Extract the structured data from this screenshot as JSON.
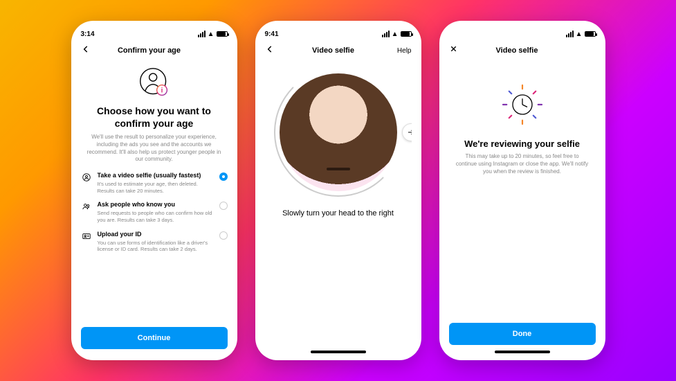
{
  "statusbar": {
    "time1": "3:14",
    "time2": "9:41",
    "time3": ""
  },
  "screen1": {
    "nav_title": "Confirm your age",
    "heading": "Choose how you want to confirm your age",
    "sub": "We'll use the result to personalize your experience, including the ads you see and the accounts we recommend. It'll also help us protect younger people in our community.",
    "options": [
      {
        "title": "Take a video selfie (usually fastest)",
        "desc": "It's used to estimate your age, then deleted. Results can take 20 minutes.",
        "selected": true
      },
      {
        "title": "Ask people who know you",
        "desc": "Send requests to people who can confirm how old you are. Results can take 3 days.",
        "selected": false
      },
      {
        "title": "Upload your ID",
        "desc": "You can use forms of identification like a driver's license or ID card. Results can take 2 days.",
        "selected": false
      }
    ],
    "cta": "Continue"
  },
  "screen2": {
    "nav_title": "Video selfie",
    "help": "Help",
    "instruction": "Slowly turn your head to the right"
  },
  "screen3": {
    "nav_title": "Video selfie",
    "heading": "We're reviewing your selfie",
    "sub": "This may take up to 20 minutes, so feel free to continue using Instagram or close the app. We'll notify you when the review is finished.",
    "cta": "Done"
  }
}
